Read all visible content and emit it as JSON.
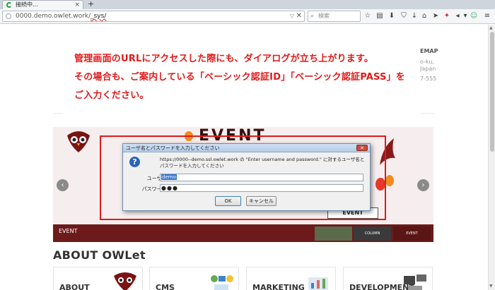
{
  "browser": {
    "tab_title": "接続中...",
    "new_tab": "+",
    "url_host": "0000.demo.owlet.work/",
    "url_path": "_sys/",
    "search_placeholder": "検索"
  },
  "page": {
    "sitemap": "EMAP",
    "address_line1": "o-ku,",
    "address_line2": "Japan",
    "tel": "7-555",
    "notice_line1": "管理画面のURLにアクセスした際にも、ダイアログが立ち上がります。",
    "notice_line2": "その場合も、ご案内している「ベーシック認証ID」「ベーシック認証PASS」を",
    "notice_line3": "ご入力ください。",
    "slider_caption": "EVENT",
    "slider_big_text": "EVENT",
    "slider_small_text": "EVENT",
    "slider_thumb_b": "COLUMN",
    "slider_thumb_c": "EVENT",
    "about_heading": "ABOUT OWLet",
    "cards": [
      {
        "title": "ABOUT"
      },
      {
        "title": "CMS"
      },
      {
        "title": "MARKETING"
      },
      {
        "title": "DEVELOPMENT"
      }
    ],
    "prev_arrow": "‹",
    "next_arrow": "›"
  },
  "dialog": {
    "title": "ユーザ名とパスワードを入力してください",
    "message": "https://0000--demo.ssl.owlet.work の \"Enter username and password.\" に対するユーザ名とパスワードを入力してください",
    "username_label": "ユーザ名:",
    "password_label": "パスワード:",
    "username_value": "demo",
    "password_value": "●●●",
    "ok_label": "OK",
    "cancel_label": "キャンセル"
  },
  "colors": {
    "notice_red": "#e01a1a",
    "slider_maroon": "#6d1a1a",
    "dialog_border": "#6f8db3"
  }
}
